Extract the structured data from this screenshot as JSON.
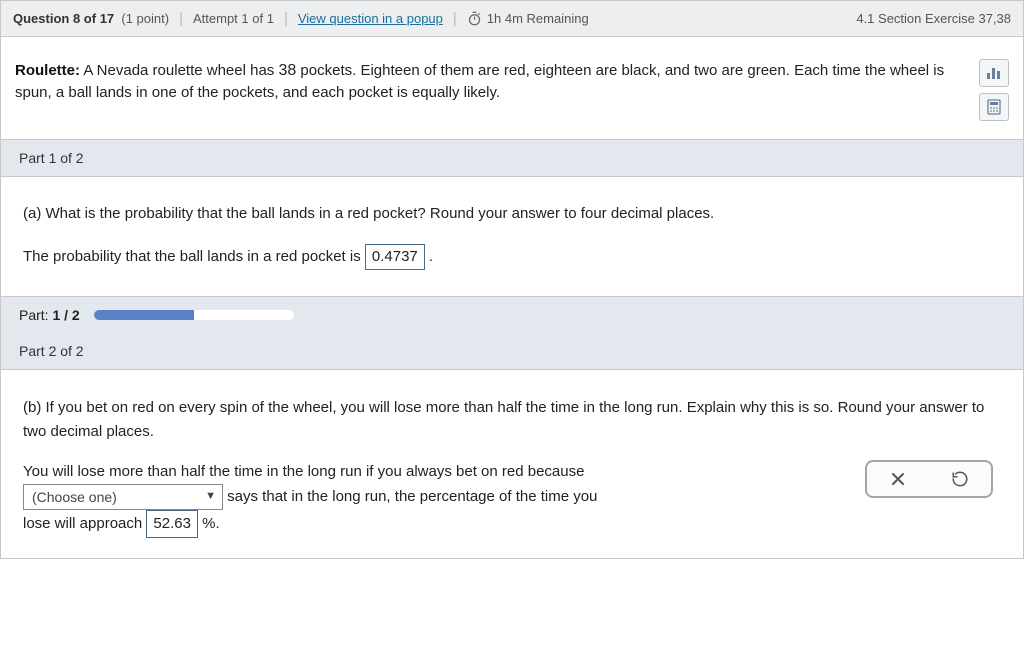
{
  "topbar": {
    "question_label_a": "Question ",
    "question_num": "8",
    "question_label_b": " of ",
    "question_total": "17",
    "points": "(1 point)",
    "attempt": "Attempt 1 of 1",
    "popup_link": "View question in a popup",
    "time_remaining": "1h 4m Remaining",
    "section_ref": "4.1 Section Exercise 37,38"
  },
  "prompt": {
    "title": "Roulette:",
    "body_a": " A Nevada roulette wheel has ",
    "pockets": "38",
    "body_b": " pockets. Eighteen of them are red, eighteen are black, and two are green. Each time the wheel is spun, a ball lands in one of the pockets, and each pocket is equally likely."
  },
  "part1": {
    "header": "Part 1 of 2",
    "question": "(a) What is the probability that the ball lands in a red pocket? Round your answer to four decimal places.",
    "sentence_a": "The probability that the ball lands in a red pocket is ",
    "answer": "0.4737",
    "sentence_b": " ."
  },
  "progress": {
    "label_a": "Part: ",
    "label_b": "1 / 2",
    "percent": 50
  },
  "part2": {
    "header": "Part 2 of 2",
    "question": "(b) If you bet on red on every spin of the wheel, you will lose more than half the time in the long run. Explain why this is so. Round your answer to two decimal places.",
    "line1": "You will lose more than half the time in the long run if you always bet on red because",
    "choose_placeholder": "(Choose one)",
    "line2_after": " says that in the long run, the percentage of the time you",
    "line3_a": "lose will approach ",
    "pct_answer": "52.63",
    "line3_b": " %."
  }
}
